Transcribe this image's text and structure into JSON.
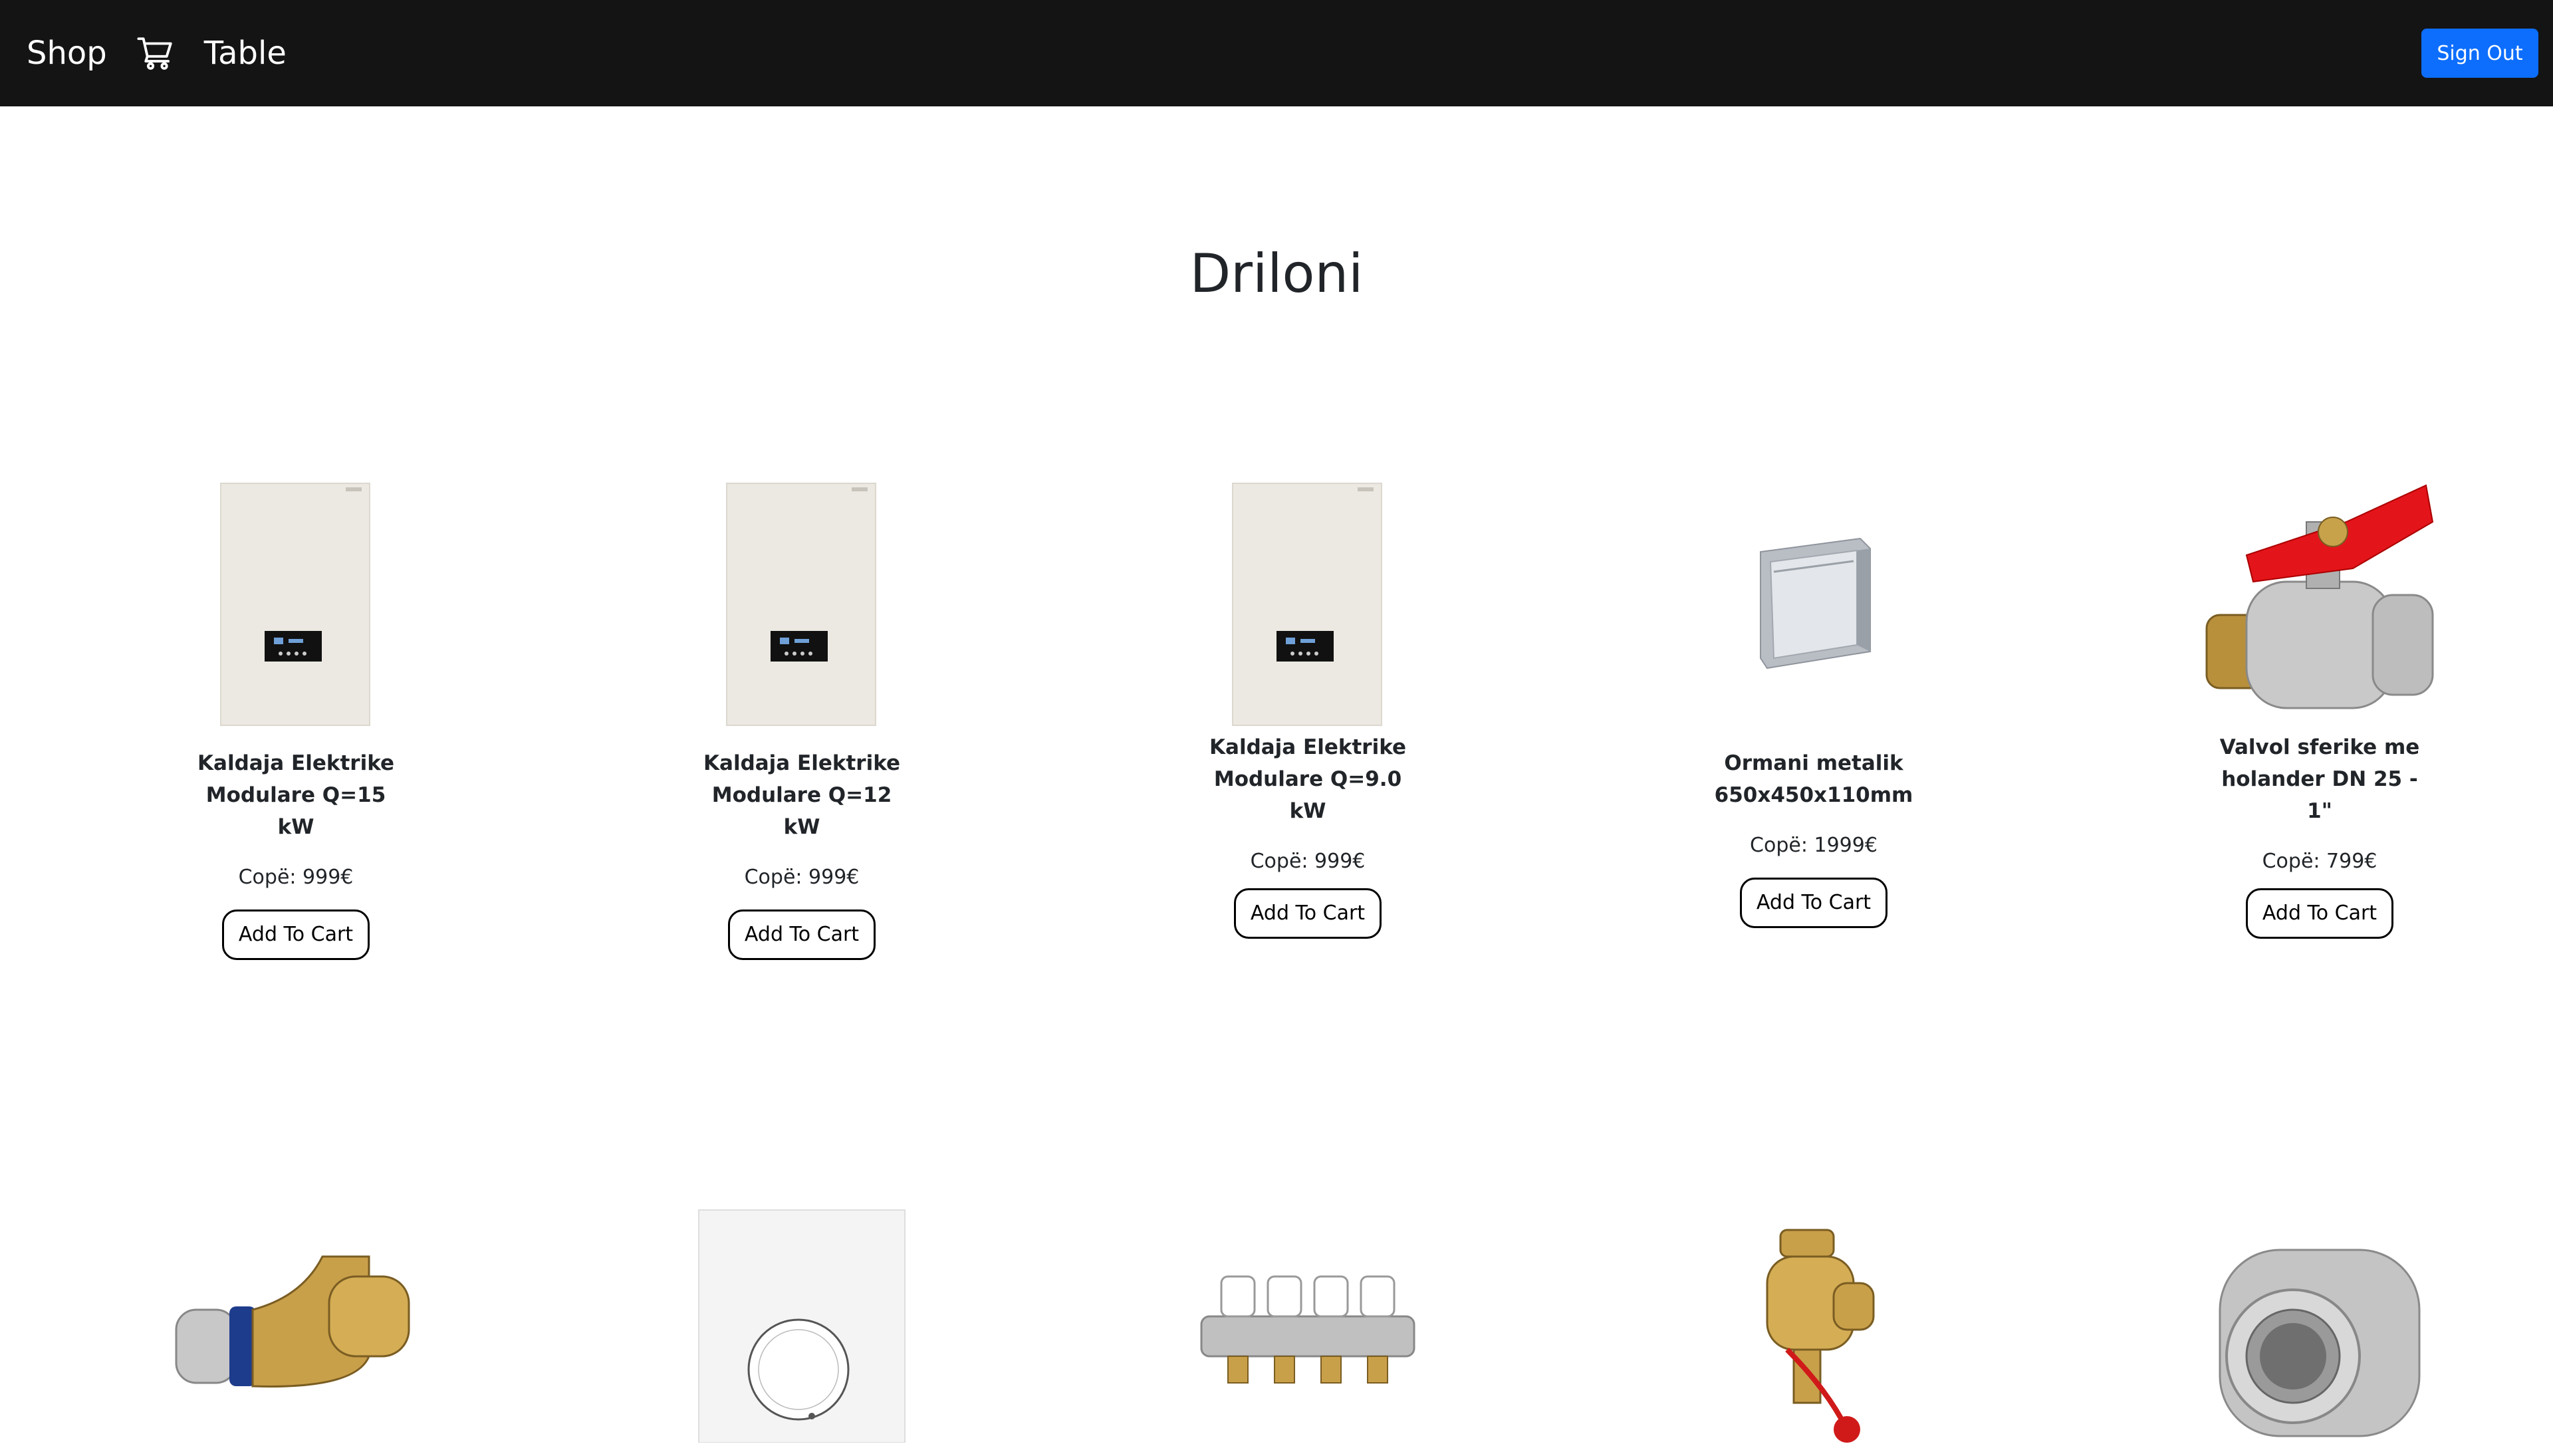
{
  "nav": {
    "brand": "Shop",
    "table_link": "Table",
    "sign_out": "Sign Out"
  },
  "page": {
    "title": "Driloni"
  },
  "products_row1": [
    {
      "name": "Kaldaja Elektrike Modulare Q=15 kW",
      "price": "Copë: 999€",
      "button": "Add To Cart",
      "icon": "boiler-image"
    },
    {
      "name": "Kaldaja Elektrike Modulare Q=12 kW",
      "price": "Copë: 999€",
      "button": "Add To Cart",
      "icon": "boiler-image"
    },
    {
      "name": "Kaldaja Elektrike Modulare Q=9.0 kW",
      "price": "Copë: 999€",
      "button": "Add To Cart",
      "icon": "boiler-image"
    },
    {
      "name": "Ormani metalik 650x450x110mm",
      "price": "Copë: 1999€",
      "button": "Add To Cart",
      "icon": "metal-cabinet-image"
    },
    {
      "name": "Valvol sferike me holander DN 25 - 1\"",
      "price": "Copë: 799€",
      "button": "Add To Cart",
      "icon": "ball-valve-image"
    }
  ],
  "products_row2": [
    {
      "icon": "elbow-fitting-image"
    },
    {
      "icon": "thermostat-image"
    },
    {
      "icon": "manifold-image"
    },
    {
      "icon": "brass-valve-image"
    },
    {
      "icon": "pipe-union-image"
    }
  ],
  "colors": {
    "navbar_bg": "#141414",
    "primary": "#0d6efd"
  }
}
